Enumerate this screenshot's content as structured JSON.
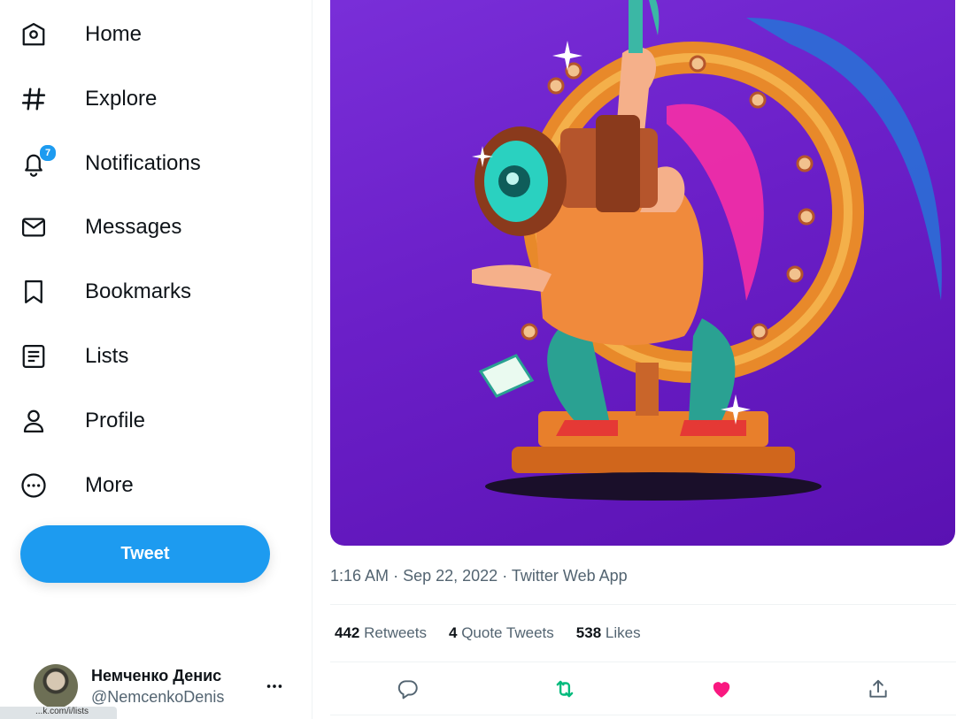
{
  "nav": {
    "home": "Home",
    "explore": "Explore",
    "notifications": "Notifications",
    "notifications_badge": "7",
    "messages": "Messages",
    "bookmarks": "Bookmarks",
    "lists": "Lists",
    "profile": "Profile",
    "more": "More"
  },
  "tweet_button": "Tweet",
  "account": {
    "name": "Немченко Денис",
    "handle": "@NemcenkoDenis",
    "more_icon": "ellipsis-icon"
  },
  "status_bar": "...k.com/i/lists",
  "tweet": {
    "time": "1:16 AM",
    "date": "Sep 22, 2022",
    "source": "Twitter Web App",
    "separator": "·",
    "retweets_count": "442",
    "retweets_label": "Retweets",
    "quotes_count": "4",
    "quotes_label": "Quote Tweets",
    "likes_count": "538",
    "likes_label": "Likes"
  },
  "colors": {
    "accent": "#1d9bf0",
    "retweet_active": "#00ba7c",
    "like_active": "#f91880",
    "secondary_text": "#536471"
  }
}
